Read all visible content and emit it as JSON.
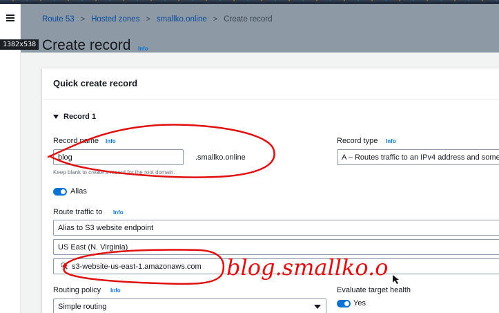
{
  "breadcrumb": [
    "Route 53",
    "Hosted zones",
    "smallko.online",
    "Create record"
  ],
  "overlay_badge": "1382x538",
  "page": {
    "title": "Create record",
    "info": "Info"
  },
  "panel": {
    "title": "Quick create record"
  },
  "record": {
    "toggle_label": "Record 1",
    "name_label": "Record name",
    "name_info": "Info",
    "name_value": "blog",
    "domain_suffix": ".smallko.online",
    "name_hint": "Keep blank to create a record for the root domain.",
    "type_label": "Record type",
    "type_info": "Info",
    "type_value": "A – Routes traffic to an IPv4 address and some"
  },
  "alias": {
    "label": "Alias",
    "enabled": true
  },
  "route": {
    "label": "Route traffic to",
    "info": "Info",
    "endpoint": "Alias to S3 website endpoint",
    "region": "US East (N. Virginia)",
    "target": "s3-website-us-east-1.amazonaws.com"
  },
  "routing": {
    "label": "Routing policy",
    "info": "Info",
    "value": "Simple routing"
  },
  "health": {
    "label": "Evaluate target health",
    "value": "Yes",
    "enabled": true
  },
  "annotation": {
    "handwriting": "blog.smallko.o",
    "color": "#e01010"
  },
  "colors": {
    "link": "#0a4a9a",
    "accent": "#0972d3",
    "top_nav": "#232f3e"
  },
  "icons": [
    "menu-icon",
    "caret-down-icon",
    "search-icon",
    "chevron-down-icon",
    "toggle-icon"
  ]
}
